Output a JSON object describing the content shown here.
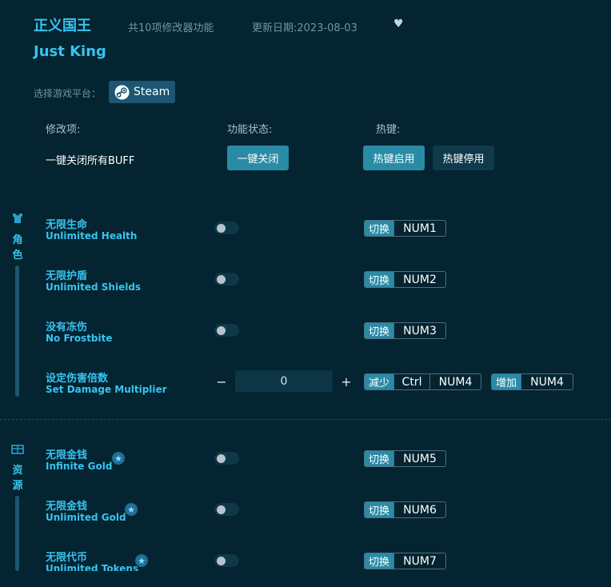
{
  "header": {
    "title_cn": "正义国王",
    "feature_count": "共10项修改器功能",
    "update_date": "更新日期:2023-08-03",
    "title_en": "Just King"
  },
  "platform": {
    "label": "选择游戏平台：",
    "steam": "Steam"
  },
  "columns": {
    "mod": "修改项:",
    "status": "功能状态:",
    "hotkey": "热键:"
  },
  "global": {
    "disable_all_buff": "一键关闭所有BUFF",
    "close_all_button": "一键关闭",
    "hotkey_enable_button": "热键启用",
    "hotkey_disable_button": "热键停用"
  },
  "sections": {
    "character": {
      "label_1": "角",
      "label_2": "色",
      "icon": "character-icon"
    },
    "resources": {
      "label_1": "资",
      "label_2": "源",
      "icon": "chest-icon"
    }
  },
  "items": [
    {
      "cn": "无限生命",
      "en": "Unlimited Health",
      "tag": "切换",
      "key": "NUM1",
      "toggle": false,
      "star": false
    },
    {
      "cn": "无限护盾",
      "en": "Unlimited Shields",
      "tag": "切换",
      "key": "NUM2",
      "toggle": false,
      "star": false
    },
    {
      "cn": "没有冻伤",
      "en": "No Frostbite",
      "tag": "切换",
      "key": "NUM3",
      "toggle": false,
      "star": false
    },
    {
      "cn": "设定伤害倍数",
      "en": "Set Damage Multiplier",
      "value": "0",
      "dec_tag": "减少",
      "dec_mod": "Ctrl",
      "dec_key": "NUM4",
      "inc_tag": "增加",
      "inc_key": "NUM4"
    },
    {
      "cn": "无限金钱",
      "en": "Infinite Gold",
      "tag": "切换",
      "key": "NUM5",
      "toggle": false,
      "star": true
    },
    {
      "cn": "无限金钱",
      "en": "Unlimited Gold",
      "tag": "切换",
      "key": "NUM6",
      "toggle": false,
      "star": true
    },
    {
      "cn": "无限代币",
      "en": "Unlimited Tokens",
      "tag": "切换",
      "key": "NUM7",
      "toggle": false,
      "star": true
    }
  ],
  "stepper": {
    "minus": "−",
    "plus": "+"
  },
  "colors": {
    "background": "#032430",
    "accent": "#38c3f0",
    "button": "#2a8ba6"
  }
}
